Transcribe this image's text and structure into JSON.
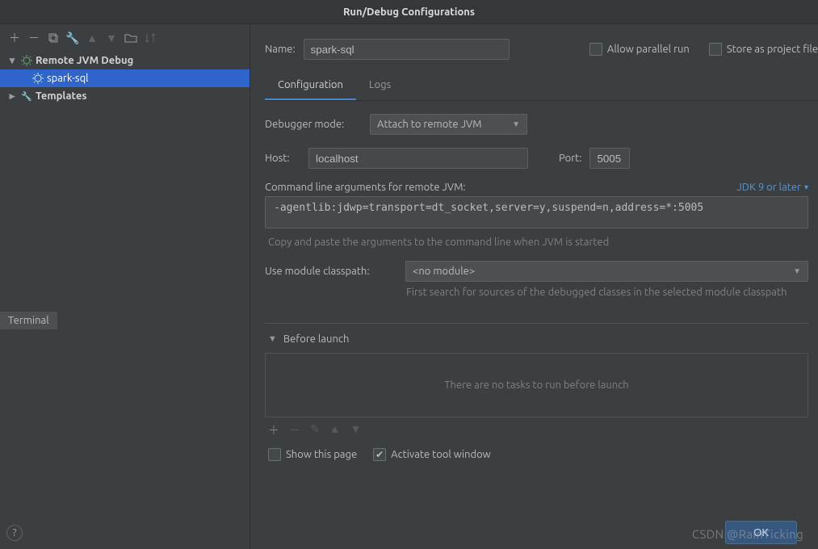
{
  "title": "Run/Debug Configurations",
  "tree": {
    "remote_jvm_debug": "Remote JVM Debug",
    "spark_sql": "spark-sql",
    "templates": "Templates"
  },
  "name_label": "Name:",
  "name_value": "spark-sql",
  "allow_parallel_label": "Allow parallel run",
  "store_project_label": "Store as project file",
  "tabs": {
    "configuration": "Configuration",
    "logs": "Logs"
  },
  "debugger_mode_label": "Debugger mode:",
  "debugger_mode_value": "Attach to remote JVM",
  "host_label": "Host:",
  "host_value": "localhost",
  "port_label": "Port:",
  "port_value": "5005",
  "cmd_args_label": "Command line arguments for remote JVM:",
  "jdk_label": "JDK 9 or later",
  "cmd_args_value": "-agentlib:jdwp=transport=dt_socket,server=y,suspend=n,address=*:5005",
  "copy_hint": "Copy and paste the arguments to the command line when JVM is started",
  "module_label": "Use module classpath:",
  "module_value": "<no module>",
  "module_hint": "First search for sources of the debugged classes in the selected module classpath",
  "before_launch_label": "Before launch",
  "before_launch_empty": "There are no tasks to run before launch",
  "show_this_page": "Show this page",
  "activate_tool_window": "Activate tool window",
  "ok_label": "OK",
  "terminal_label": "Terminal",
  "watermark": "CSDN @RainTicking"
}
